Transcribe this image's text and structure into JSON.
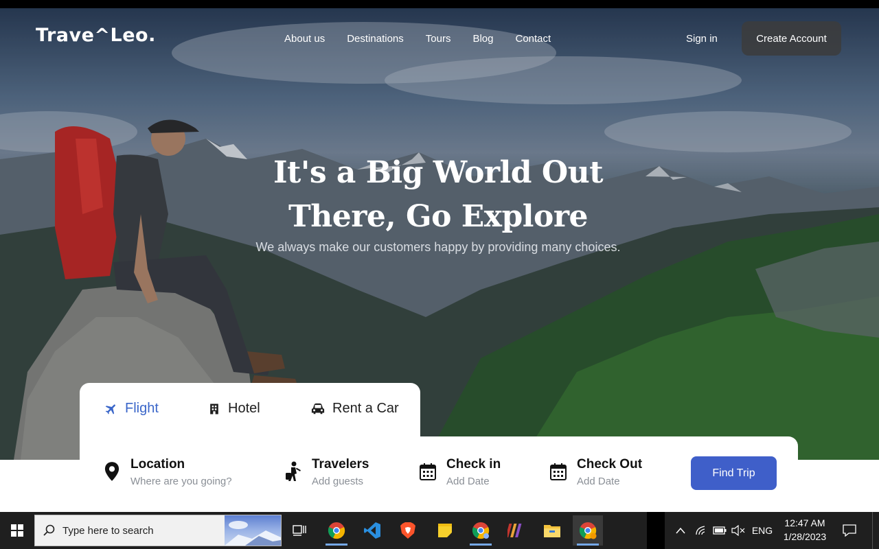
{
  "brand": {
    "logo_text": "Trave^Leo."
  },
  "nav": {
    "links": [
      "About us",
      "Destinations",
      "Tours",
      "Blog",
      "Contact"
    ],
    "sign_in": "Sign in",
    "create_account": "Create Account"
  },
  "hero": {
    "headline_line1": "It's a Big World Out",
    "headline_line2": "There, Go Explore",
    "subheading": "We always make our customers happy by providing many choices."
  },
  "booking": {
    "tabs": [
      {
        "label": "Flight",
        "icon": "plane-icon",
        "active": true
      },
      {
        "label": "Hotel",
        "icon": "hotel-icon",
        "active": false
      },
      {
        "label": "Rent a Car",
        "icon": "car-icon",
        "active": false
      }
    ],
    "fields": [
      {
        "label": "Location",
        "placeholder": "Where are you going?",
        "icon": "location-pin-icon"
      },
      {
        "label": "Travelers",
        "placeholder": "Add guests",
        "icon": "traveler-icon"
      },
      {
        "label": "Check in",
        "placeholder": "Add Date",
        "icon": "calendar-icon"
      },
      {
        "label": "Check Out",
        "placeholder": "Add Date",
        "icon": "calendar-icon"
      }
    ],
    "submit_label": "Find Trip"
  },
  "colors": {
    "accent": "#3f5fc9",
    "active_tab": "#3a66c9",
    "taskbar": "#1f1f1f"
  },
  "taskbar": {
    "search_placeholder": "Type here to search",
    "apps": [
      "task-view",
      "chrome",
      "vs-code",
      "brave",
      "sticky-notes",
      "chrome-profile",
      "winrar",
      "file-explorer",
      "chrome-canary"
    ],
    "language": "ENG",
    "time": "12:47 AM",
    "date": "1/28/2023"
  }
}
